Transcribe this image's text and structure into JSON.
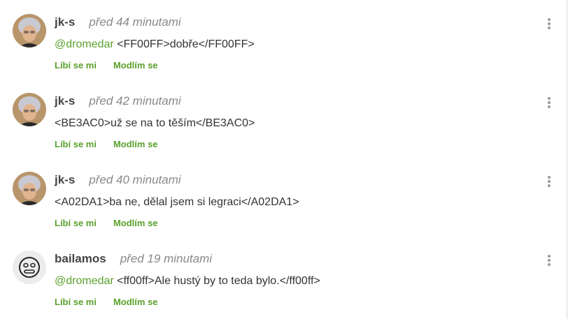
{
  "comments": [
    {
      "username": "jk-s",
      "time": "před 44 minutami",
      "mention": "@dromedar",
      "text": " <FF00FF>dobře</FF00FF>",
      "like": "Líbí se mi",
      "pray": "Modlím se",
      "avatar": "user-photo"
    },
    {
      "username": "jk-s",
      "time": "před 42 minutami",
      "mention": "",
      "text": "<BE3AC0>už se na to těším</BE3AC0>",
      "like": "Líbí se mi",
      "pray": "Modlím se",
      "avatar": "user-photo"
    },
    {
      "username": "jk-s",
      "time": "před 40 minutami",
      "mention": "",
      "text": "<A02DA1>ba ne, dělal jsem si legraci</A02DA1>",
      "like": "Líbí se mi",
      "pray": "Modlím se",
      "avatar": "user-photo"
    },
    {
      "username": "bailamos",
      "time": "před 19 minutami",
      "mention": "@dromedar",
      "text": " <ff00ff>Ale hustý by to teda bylo.</ff00ff>",
      "like": "Líbí se mi",
      "pray": "Modlím se",
      "avatar": "neutral-face-icon"
    }
  ],
  "colors": {
    "accent": "#5aa02c",
    "username": "#444444",
    "timestamp": "#888888",
    "text": "#333333"
  }
}
